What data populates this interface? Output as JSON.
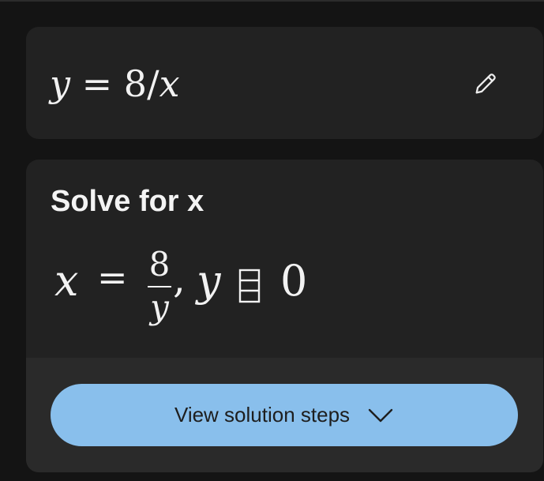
{
  "equation": {
    "lhs": "y",
    "equals": "=",
    "rhs_number": "8/",
    "rhs_var": "x",
    "edit_icon": "pencil-icon"
  },
  "result": {
    "title": "Solve for x",
    "var": "x",
    "equals": "=",
    "numerator": "8",
    "denominator": "y",
    "comma": ",",
    "condition_var": "y",
    "condition_symbol": "missing-glyph-box",
    "condition_value": "0"
  },
  "steps_button": {
    "label": "View solution steps",
    "icon": "chevron-down-icon"
  },
  "colors": {
    "background": "#141414",
    "card": "#222222",
    "button": "#89bfec",
    "text": "#f2f2f2"
  }
}
